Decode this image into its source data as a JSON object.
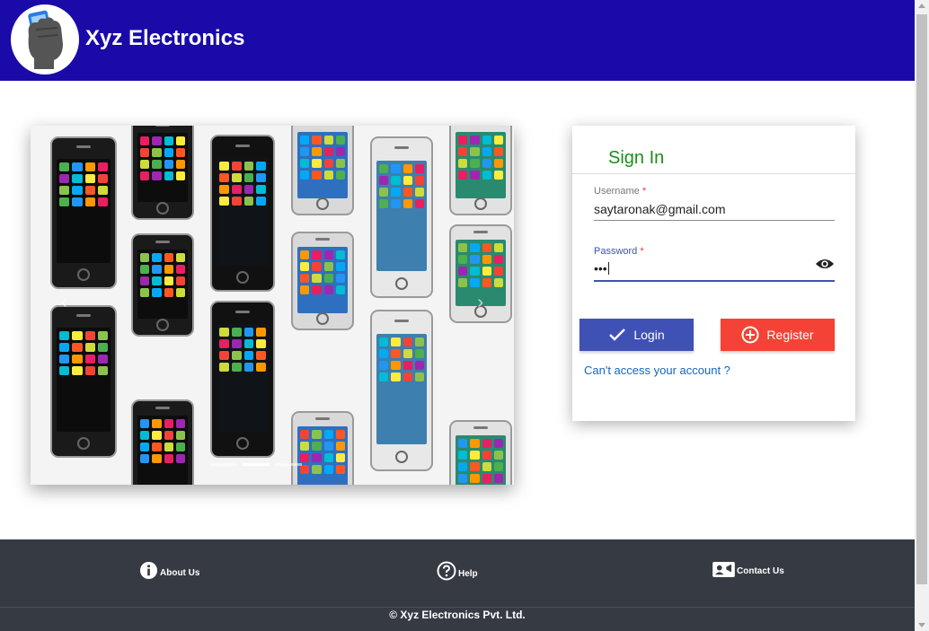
{
  "header": {
    "brand": "Xyz Electronics"
  },
  "carousel": {
    "prev_symbol": "‹",
    "next_symbol": "›",
    "slides": 3,
    "active_slide": 1
  },
  "login": {
    "title": "Sign In",
    "username": {
      "label": "Username",
      "required_mark": "*",
      "value": "saytaronak@gmail.com"
    },
    "password": {
      "label": "Password",
      "required_mark": "*",
      "masked_value": "•••"
    },
    "login_label": "Login",
    "register_label": "Register",
    "forgot_label": "Can't access your account ?"
  },
  "footer": {
    "about": "About Us",
    "help": "Help",
    "contact": "Contact Us",
    "copyright": "© Xyz Electronics Pvt. Ltd."
  },
  "colors": {
    "header": "#1a0aa8",
    "title_green": "#1a8f1a",
    "login_button": "#3f51b5",
    "register_button": "#f44336",
    "footer": "#363a43",
    "link": "#1565c0"
  }
}
